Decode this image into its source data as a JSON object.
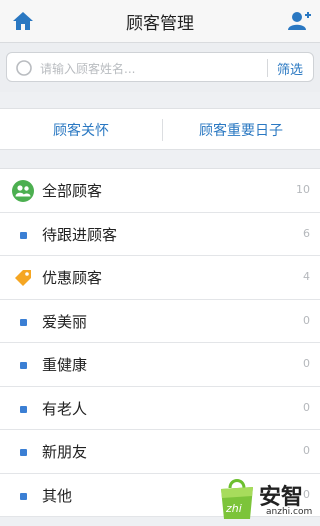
{
  "header": {
    "title": "顾客管理",
    "home_icon": "home-icon",
    "add_icon": "add-user-icon"
  },
  "search": {
    "placeholder": "请输入顾客姓名...",
    "filter_label": "筛选"
  },
  "quick_links": {
    "care": "顾客关怀",
    "dates": "顾客重要日子"
  },
  "groups": [
    {
      "label": "全部顾客",
      "count": "10",
      "icon": "group-icon"
    },
    {
      "label": "待跟进顾客",
      "count": "6",
      "icon": "dot"
    },
    {
      "label": "优惠顾客",
      "count": "4",
      "icon": "tag-icon"
    },
    {
      "label": "爱美丽",
      "count": "0",
      "icon": "dot"
    },
    {
      "label": "重健康",
      "count": "0",
      "icon": "dot"
    },
    {
      "label": "有老人",
      "count": "0",
      "icon": "dot"
    },
    {
      "label": "新朋友",
      "count": "0",
      "icon": "dot"
    },
    {
      "label": "其他",
      "count": "0",
      "icon": "dot"
    }
  ],
  "watermark": {
    "brand": "安智",
    "url": "anzhi.com"
  },
  "colors": {
    "accent": "#2a78c2",
    "dot": "#3b7fd4",
    "group_icon": "#4caf50",
    "tag_icon": "#f5a623"
  }
}
